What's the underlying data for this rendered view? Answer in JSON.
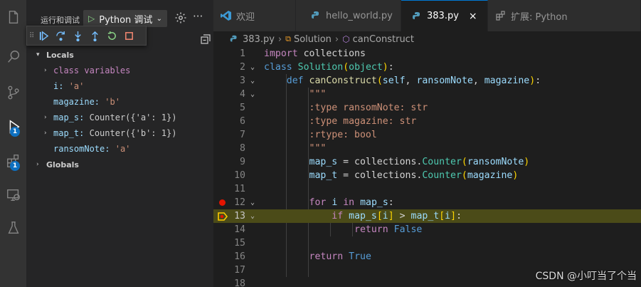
{
  "activity_bar": {
    "debug_badge": "1",
    "extensions_badge": "1"
  },
  "sidebar": {
    "title": "运行和调试",
    "config": "Python 调试",
    "scopes": [
      {
        "label": "Locals"
      },
      {
        "label": "Globals"
      }
    ],
    "variables": [
      {
        "name": "class variables",
        "value": ""
      },
      {
        "name": "i:",
        "value": "'a'"
      },
      {
        "name": "magazine:",
        "value": "'b'"
      },
      {
        "name": "map_s:",
        "value": "Counter({'a': 1})"
      },
      {
        "name": "map_t:",
        "value": "Counter({'b': 1})"
      },
      {
        "name": "ransomNote:",
        "value": "'a'"
      }
    ]
  },
  "tabs": [
    {
      "label": "欢迎"
    },
    {
      "label": "hello_world.py"
    },
    {
      "label": "383.py",
      "close": "×"
    },
    {
      "label": "扩展: Python"
    }
  ],
  "breadcrumb": {
    "file": "383.py",
    "class": "Solution",
    "method": "canConstruct"
  },
  "code": {
    "line_numbers": [
      "1",
      "2",
      "3",
      "4",
      "5",
      "6",
      "7",
      "8",
      "9",
      "10",
      "11",
      "12",
      "13",
      "14",
      "15",
      "16",
      "17",
      "18"
    ],
    "current_line": 13,
    "breakpoint_line": 12
  },
  "watermark": "CSDN @小叮当了个当",
  "colors": {
    "accent": "#0078d4",
    "breakpoint": "#e51400",
    "current_line": "#4b4b18"
  }
}
